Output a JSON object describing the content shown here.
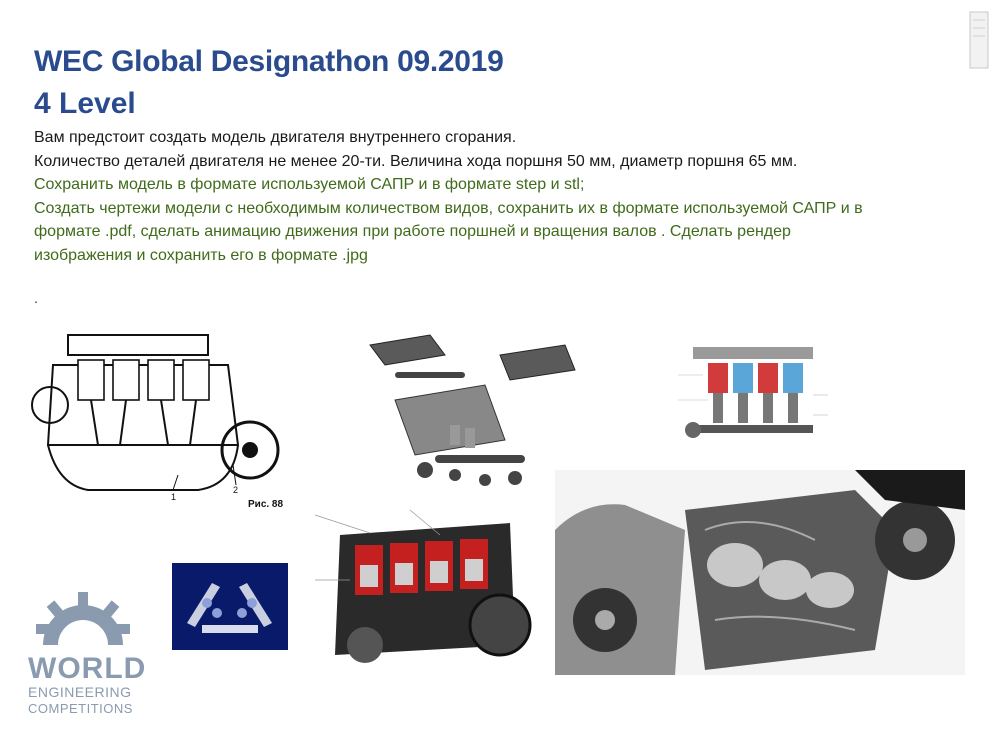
{
  "header": {
    "title": "WEC Global Designathon 09.2019",
    "subtitle": "4 Level"
  },
  "body": {
    "lines_black": [
      "Вам предстоит создать модель двигателя внутреннего сгорания.",
      "Количество деталей двигателя не менее 20-ти. Величина хода поршня 50 мм, диаметр поршня 65 мм."
    ],
    "lines_green": [
      "Сохранить модель в формате используемой САПР и в формате step и stl;",
      "Создать чертежи модели с необходимым количеством видов, сохранить их в формате используемой САПР и в",
      "формате .pdf,  сделать анимацию движения при работе поршней и вращения валов . Сделать рендер",
      "изображения и сохранить его в формате .jpg"
    ],
    "stray_mark": "."
  },
  "figures": {
    "drawing_caption": "Рис. 88",
    "drawing_callouts": [
      "1",
      "2"
    ]
  },
  "logo": {
    "word1": "WORLD",
    "word2": "ENGINEERING",
    "word3": "COMPETITIONS"
  },
  "colors": {
    "title": "#2a4b8d",
    "accent_green": "#3f6b1a",
    "logo_gray": "#8a9bb0"
  }
}
